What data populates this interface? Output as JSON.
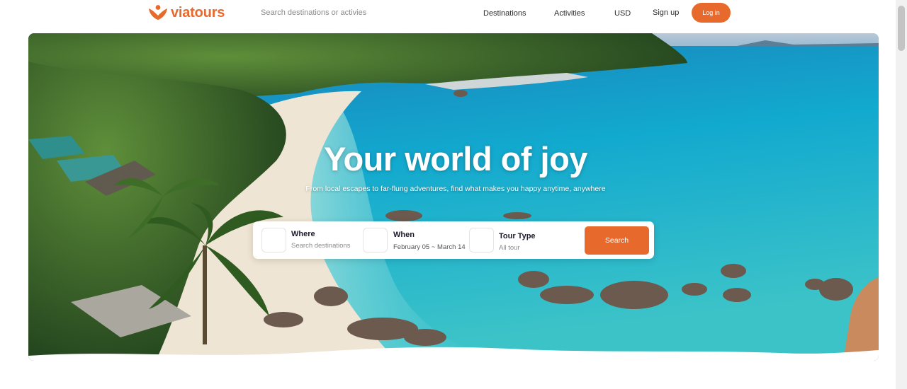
{
  "header": {
    "brand": "viatours",
    "search_placeholder": "Search destinations or activies",
    "nav": {
      "destinations": "Destinations",
      "activities": "Activities",
      "currency": "USD",
      "signup": "Sign up",
      "login": "Log in"
    }
  },
  "hero": {
    "title": "Your world of joy",
    "subtitle": "From local escapes to far-flung adventures, find what makes you happy anytime, anywhere"
  },
  "search_panel": {
    "where": {
      "label": "Where",
      "placeholder": "Search destinations"
    },
    "when": {
      "label": "When",
      "value": "February 05 ~ March 14"
    },
    "tour_type": {
      "label": "Tour Type",
      "value": "All tour"
    },
    "search_button": "Search"
  },
  "colors": {
    "brand": "#E8692C",
    "text_dark": "#1c1c2e",
    "muted": "#8b8b8b"
  },
  "icons": {
    "logo": "viatours-heart-logo-icon"
  }
}
